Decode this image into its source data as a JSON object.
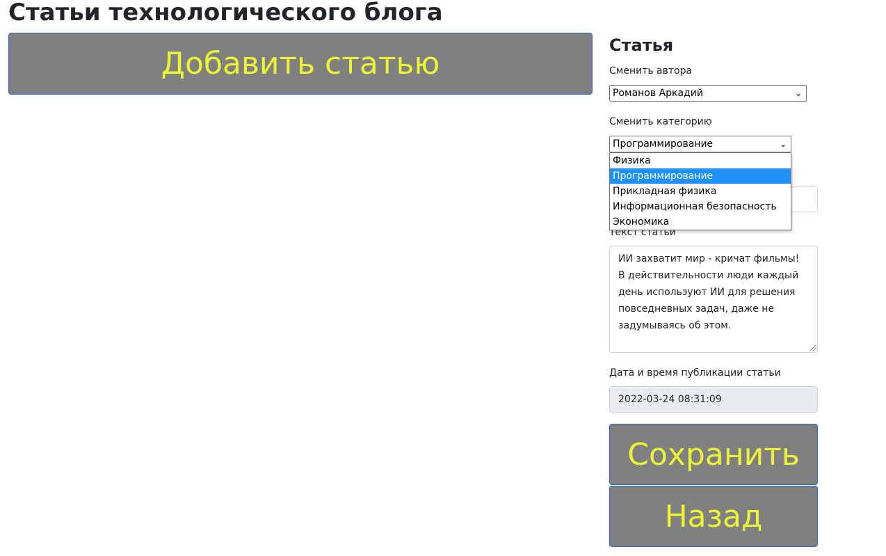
{
  "page": {
    "title": "Статьи технологического блога",
    "add_button": "Добавить статью"
  },
  "article_form": {
    "heading": "Статья",
    "author_label": "Сменить автора",
    "author_value": "Романов Аркадий",
    "category_label": "Сменить категорию",
    "category_value": "Программирование",
    "category_options": [
      "Физика",
      "Программирование",
      "Прикладная физика",
      "Информационная безопасность",
      "Экономика"
    ],
    "category_selected_index": 1,
    "text_label": "Текст статьи",
    "text_value": "ИИ захватит мир - кричат фильмы! В действительности люди каждый день используют ИИ для решения повседневных задач, даже не задумываясь об этом.",
    "date_label": "Дата и время публикации статьи",
    "date_value": "2022-03-24 08:31:09",
    "save_button": "Сохранить",
    "back_button": "Назад"
  },
  "colors": {
    "button_bg": "#808080",
    "button_text": "#ebf535",
    "button_border": "#2f6bbf",
    "selected_option": "#1e90ff"
  },
  "icons": {
    "select_arrow": "chevron-down-icon"
  }
}
